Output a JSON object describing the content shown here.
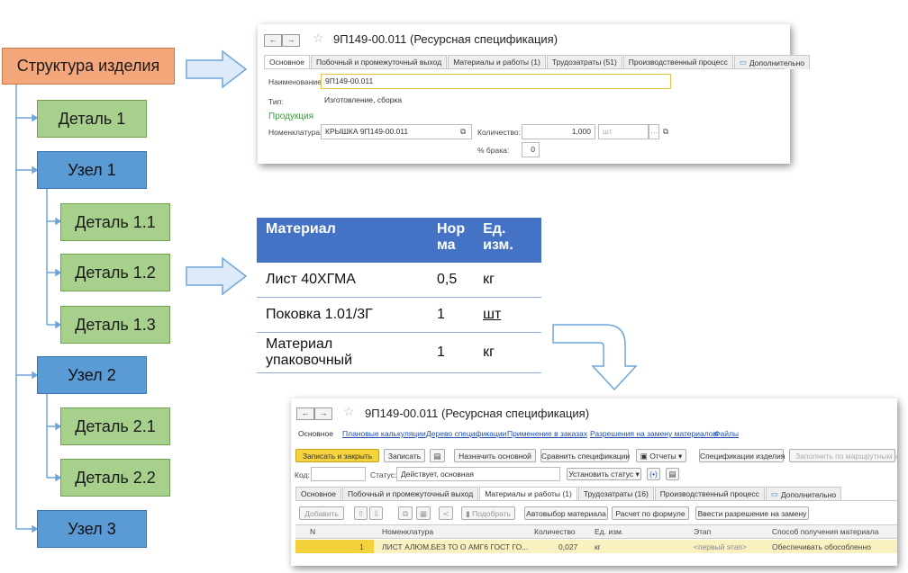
{
  "tree": {
    "root": "Структура изделия",
    "items": [
      "Деталь 1",
      "Узел 1",
      "Деталь 1.1",
      "Деталь 1.2",
      "Деталь 1.3",
      "Узел 2",
      "Деталь 2.1",
      "Деталь 2.2",
      "Узел 3"
    ]
  },
  "colors": {
    "root": "#f5a77c",
    "detail": "#a7d08c",
    "assembly": "#5b9bd5",
    "table_header": "#4472c4"
  },
  "win1": {
    "nav_back": "←",
    "nav_fwd": "→",
    "title": "9П149-00.011 (Ресурсная спецификация)",
    "tabs": [
      "Основное",
      "Побочный и промежуточный выход",
      "Материалы и работы (1)",
      "Трудозатраты (51)",
      "Производственный процесс",
      "Дополнительно"
    ],
    "name_label": "Наименование:",
    "name_value": "9П149-00.011",
    "type_label": "Тип:",
    "type_value": "Изготовление, сборка",
    "section": "Продукция",
    "nom_label": "Номенклатура:",
    "nom_value": "КРЫШКА 9П149-00.011",
    "qty_label": "Количество:",
    "qty_value": "1,000",
    "unit_value": "шт",
    "defect_label": "% брака:",
    "defect_value": "0"
  },
  "materials": {
    "headers": [
      "Материал",
      "Нор ма",
      "Ед. изм."
    ],
    "rows": [
      [
        "Лист 40ХГМА",
        "0,5",
        "кг"
      ],
      [
        "Поковка 1.01/3Г",
        "1",
        "шт"
      ],
      [
        "Материал упаковочный",
        "1",
        "кг"
      ]
    ]
  },
  "win2": {
    "nav_back": "←",
    "nav_fwd": "→",
    "title": "9П149-00.011 (Ресурсная спецификация)",
    "links": [
      "Основное",
      "Плановые калькуляции",
      "Дерево спецификации",
      "Применение в заказах",
      "Разрешения на замену материалов",
      "Файлы"
    ],
    "btn_save_close": "Записать и закрыть",
    "btn_save": "Записать",
    "btn_set_main": "Назначить основной",
    "btn_compare": "Сравнить спецификации",
    "btn_reports": "Отчеты",
    "btn_item_specs": "Спецификации изделия",
    "btn_fill_route": "Заполнить по маршрутным ка",
    "code_label": "Код:",
    "status_label": "Статус:",
    "status_value": "Действует, основная",
    "btn_set_status": "Установить статус",
    "tabs": [
      "Основное",
      "Побочный и промежуточный выход",
      "Материалы и работы (1)",
      "Трудозатраты (16)",
      "Производственный процесс",
      "Дополнительно"
    ],
    "btn_add": "Добавить",
    "btn_pick": "Подобрать",
    "btn_auto": "Автовыбор материала",
    "btn_formula": "Расчет по формуле",
    "btn_permit": "Ввести разрешение на замену",
    "columns": [
      "N",
      "Номенклатура",
      "Количество",
      "Ед. изм.",
      "Этап",
      "Способ получения материала"
    ],
    "row": [
      "1",
      "ЛИСТ АЛЮМ.БЕЗ ТО О АМГ6 ГОСТ ГО...",
      "0,027",
      "кг",
      "<первый этап>",
      "Обеспечивать обособленно"
    ]
  }
}
